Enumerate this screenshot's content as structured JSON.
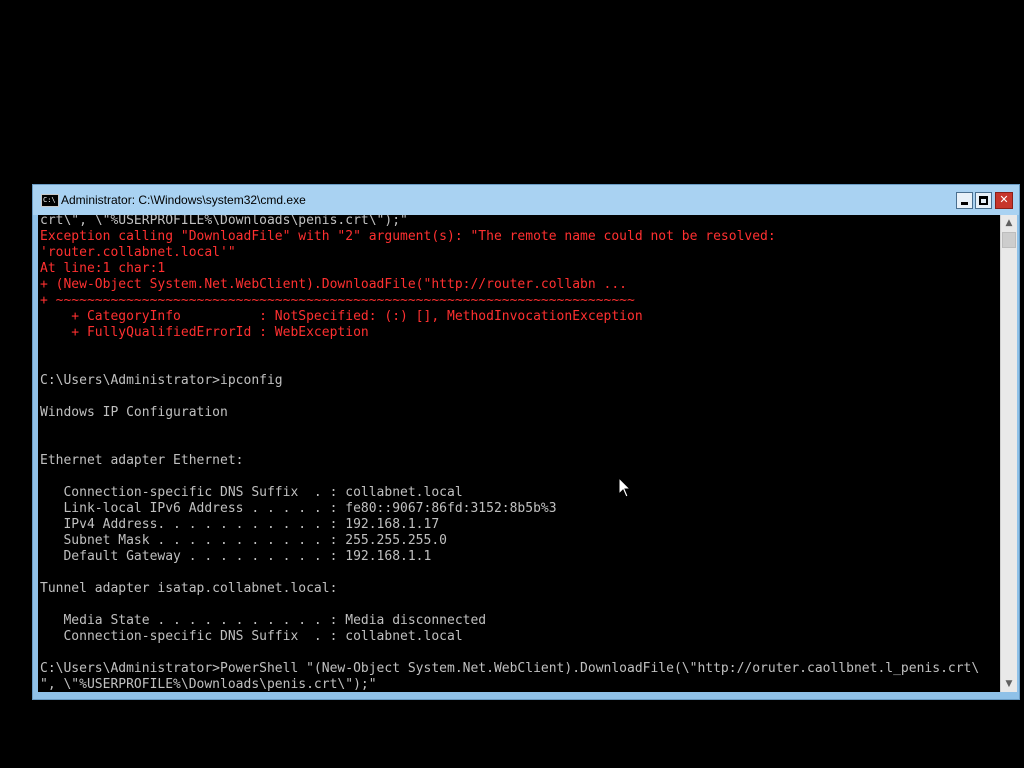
{
  "window": {
    "title": "Administrator: C:\\Windows\\system32\\cmd.exe",
    "icon_label": "C:\\",
    "controls": {
      "minimize": "minimize-icon",
      "maximize": "maximize-icon",
      "close": "close-icon",
      "close_glyph": "✕"
    },
    "colors": {
      "titlebar": "#a9d2f2",
      "close_button": "#c7352b",
      "console_bg": "#000000",
      "console_text": "#c0c0c0",
      "error_text": "#ff3030"
    }
  },
  "console": {
    "lines": [
      "crt\\\", \\\"%USERPROFILE%\\Downloads\\penis.crt\\\");\"",
      "Exception calling \"DownloadFile\" with \"2\" argument(s): \"The remote name could not be resolved:",
      "'router.collabnet.local'\"",
      "At line:1 char:1",
      "+ (New-Object System.Net.WebClient).DownloadFile(\"http://router.collabn ...",
      "+ ~~~~~~~~~~~~~~~~~~~~~~~~~~~~~~~~~~~~~~~~~~~~~~~~~~~~~~~~~~~~~~~~~~~~~~~~~~",
      "    + CategoryInfo          : NotSpecified: (:) [], MethodInvocationException",
      "    + FullyQualifiedErrorId : WebException",
      "",
      "",
      "C:\\Users\\Administrator>ipconfig",
      "",
      "Windows IP Configuration",
      "",
      "",
      "Ethernet adapter Ethernet:",
      "",
      "   Connection-specific DNS Suffix  . : collabnet.local",
      "   Link-local IPv6 Address . . . . . : fe80::9067:86fd:3152:8b5b%3",
      "   IPv4 Address. . . . . . . . . . . : 192.168.1.17",
      "   Subnet Mask . . . . . . . . . . . : 255.255.255.0",
      "   Default Gateway . . . . . . . . . : 192.168.1.1",
      "",
      "Tunnel adapter isatap.collabnet.local:",
      "",
      "   Media State . . . . . . . . . . . : Media disconnected",
      "   Connection-specific DNS Suffix  . : collabnet.local",
      "",
      "C:\\Users\\Administrator>PowerShell \"(New-Object System.Net.WebClient).DownloadFile(\\\"http://oruter.caollbnet.l_penis.crt\\",
      "\", \\\"%USERPROFILE%\\Downloads\\penis.crt\\\");\""
    ]
  },
  "scrollbar": {
    "up_arrow": "▲",
    "down_arrow": "▼"
  }
}
